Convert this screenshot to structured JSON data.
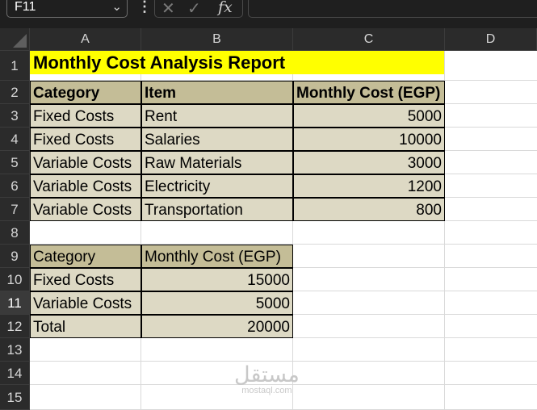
{
  "formula_bar": {
    "name_box": "F11",
    "fx_label": "fx"
  },
  "columns": [
    "A",
    "B",
    "C",
    "D"
  ],
  "rows": [
    "1",
    "2",
    "3",
    "4",
    "5",
    "6",
    "7",
    "8",
    "9",
    "10",
    "11",
    "12",
    "13",
    "14",
    "15"
  ],
  "selected_row": "11",
  "title": "Monthly Cost Analysis Report",
  "main_table": {
    "headers": [
      "Category",
      "Item",
      "Monthly Cost (EGP)"
    ],
    "rows": [
      [
        "Fixed Costs",
        "Rent",
        "5000"
      ],
      [
        "Fixed Costs",
        "Salaries",
        "10000"
      ],
      [
        "Variable Costs",
        "Raw Materials",
        "3000"
      ],
      [
        "Variable Costs",
        "Electricity",
        "1200"
      ],
      [
        "Variable Costs",
        "Transportation",
        "800"
      ]
    ]
  },
  "summary_table": {
    "headers": [
      "Category",
      "Monthly Cost (EGP)"
    ],
    "rows": [
      [
        "Fixed Costs",
        "15000"
      ],
      [
        "Variable Costs",
        "5000"
      ],
      [
        "Total",
        "20000"
      ]
    ]
  },
  "watermark": {
    "logo": "مستقل",
    "url": "mostaql.com"
  },
  "colors": {
    "title_fill": "#ffff00",
    "header_fill": "#c4bd97",
    "body_fill": "#ddd9c4",
    "app_bg": "#1f1f1f"
  }
}
